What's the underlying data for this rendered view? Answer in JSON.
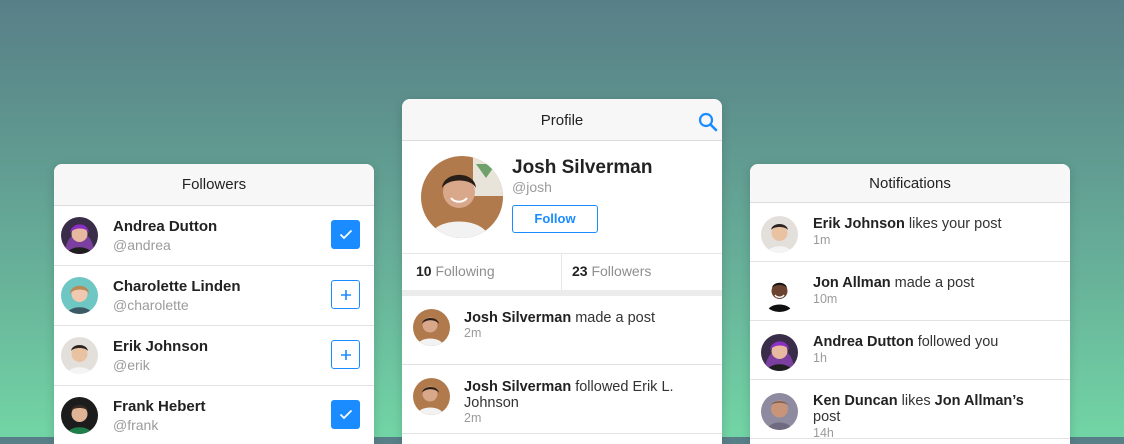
{
  "colors": {
    "accent": "#1a8cff",
    "bg_top": "#587f88",
    "bg_bottom": "#72d5a5"
  },
  "followers": {
    "title": "Followers",
    "items": [
      {
        "name": "Andrea Dutton",
        "handle": "@andrea",
        "following": true,
        "avatar": "avatar-andrea"
      },
      {
        "name": "Charolette Linden",
        "handle": "@charolette",
        "following": false,
        "avatar": "avatar-charolette"
      },
      {
        "name": "Erik Johnson",
        "handle": "@erik",
        "following": false,
        "avatar": "avatar-erik"
      },
      {
        "name": "Frank Hebert",
        "handle": "@frank",
        "following": true,
        "avatar": "avatar-frank"
      }
    ]
  },
  "profile": {
    "title": "Profile",
    "search_icon": "search-icon",
    "name": "Josh Silverman",
    "handle": "@josh",
    "follow_label": "Follow",
    "following_count": "10",
    "following_label": "Following",
    "followers_count": "23",
    "followers_label": "Followers",
    "feed": [
      {
        "actor": "Josh Silverman",
        "action": "made a post",
        "time": "2m"
      },
      {
        "actor": "Josh Silverman",
        "action": "followed Erik L. Johnson",
        "time": "2m"
      }
    ]
  },
  "notifications": {
    "title": "Notifications",
    "items": [
      {
        "actor": "Erik Johnson",
        "action": "likes your post",
        "object": "",
        "object_suffix": "",
        "time": "1m"
      },
      {
        "actor": "Jon Allman",
        "action": "made a post",
        "object": "",
        "object_suffix": "",
        "time": "10m"
      },
      {
        "actor": "Andrea Dutton",
        "action": "followed you",
        "object": "",
        "object_suffix": "",
        "time": "1h"
      },
      {
        "actor": "Ken Duncan",
        "action": "likes",
        "object": "Jon Allman’s",
        "object_suffix": "post",
        "time": "14h"
      }
    ]
  }
}
